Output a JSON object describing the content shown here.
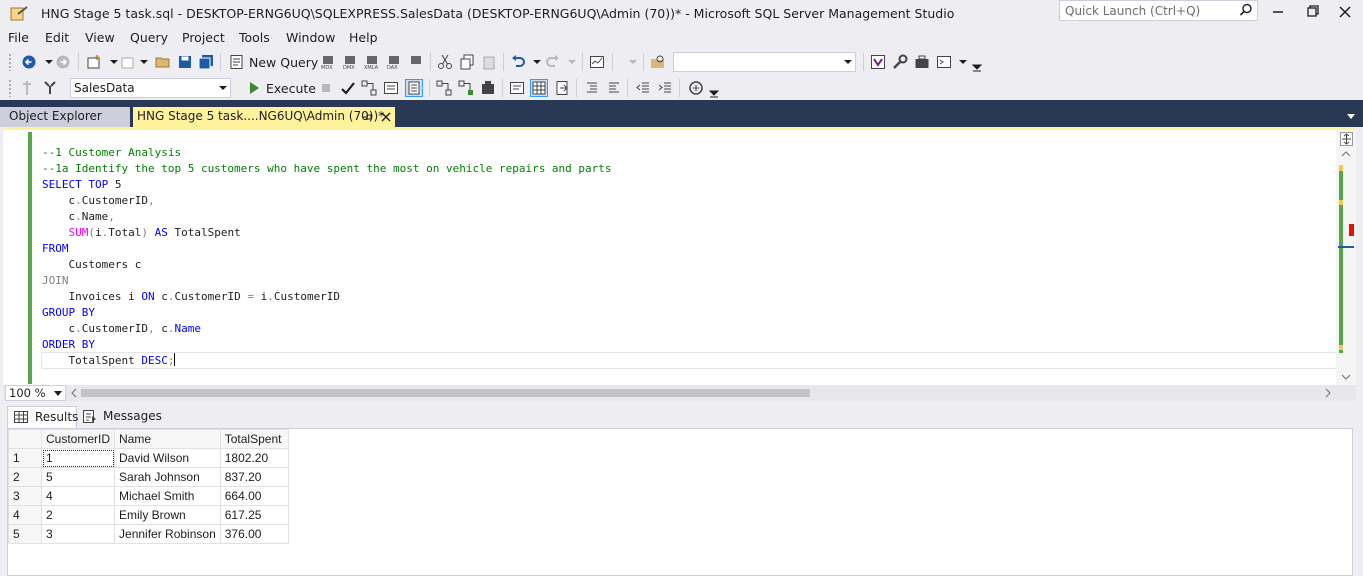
{
  "window": {
    "title": "HNG Stage 5 task.sql - DESKTOP-ERNG6UQ\\SQLEXPRESS.SalesData (DESKTOP-ERNG6UQ\\Admin (70))* - Microsoft SQL Server Management Studio",
    "quick_launch_placeholder": "Quick Launch (Ctrl+Q)"
  },
  "menu": [
    "File",
    "Edit",
    "View",
    "Query",
    "Project",
    "Tools",
    "Window",
    "Help"
  ],
  "toolbar": {
    "new_query_label": "New Query",
    "database": "SalesData",
    "execute_label": "Execute",
    "icons": [
      "back-icon",
      "forward-icon",
      "new-project-icon",
      "open-icon",
      "save-icon",
      "save-all-icon",
      "mdx-query-icon",
      "dmx-query-icon",
      "xmla-query-icon",
      "dax-query-icon",
      "cut-icon",
      "copy-icon",
      "paste-icon",
      "undo-icon",
      "redo-icon",
      "activity-monitor-icon",
      "solution-explorer-icon",
      "properties-icon",
      "toolbox-icon",
      "terminal-icon"
    ]
  },
  "tabs": {
    "object_explorer": "Object Explorer",
    "query_tab": "HNG Stage 5 task....NG6UQ\\Admin (70))*"
  },
  "editor": {
    "zoom": "100 %",
    "lines": [
      [
        [
          "cm",
          "--1 Customer Analysis"
        ]
      ],
      [
        [
          "cm",
          "--1a Identify the top 5 customers who have spent the most on vehicle repairs and parts"
        ]
      ],
      [
        [
          "kw",
          "SELECT TOP"
        ],
        [
          "tx",
          " 5"
        ]
      ],
      [
        [
          "tx",
          "    c"
        ],
        [
          "gr",
          "."
        ],
        [
          "tx",
          "CustomerID"
        ],
        [
          "gr",
          ","
        ]
      ],
      [
        [
          "tx",
          "    c"
        ],
        [
          "gr",
          "."
        ],
        [
          "tx",
          "Name"
        ],
        [
          "gr",
          ","
        ]
      ],
      [
        [
          "tx",
          "    "
        ],
        [
          "fn",
          "SUM"
        ],
        [
          "gr",
          "("
        ],
        [
          "tx",
          "i"
        ],
        [
          "gr",
          "."
        ],
        [
          "tx",
          "Total"
        ],
        [
          "gr",
          ")"
        ],
        [
          "tx",
          " "
        ],
        [
          "kw",
          "AS"
        ],
        [
          "tx",
          " TotalSpent"
        ]
      ],
      [
        [
          "kw",
          "FROM"
        ]
      ],
      [
        [
          "tx",
          "    Customers c"
        ]
      ],
      [
        [
          "gr",
          "JOIN"
        ]
      ],
      [
        [
          "tx",
          "    Invoices i "
        ],
        [
          "kw",
          "ON"
        ],
        [
          "tx",
          " c"
        ],
        [
          "gr",
          "."
        ],
        [
          "tx",
          "CustomerID "
        ],
        [
          "gr",
          "="
        ],
        [
          "tx",
          " i"
        ],
        [
          "gr",
          "."
        ],
        [
          "tx",
          "CustomerID"
        ]
      ],
      [
        [
          "kw",
          "GROUP BY"
        ]
      ],
      [
        [
          "tx",
          "    c"
        ],
        [
          "gr",
          "."
        ],
        [
          "tx",
          "CustomerID"
        ],
        [
          "gr",
          ","
        ],
        [
          "tx",
          " c"
        ],
        [
          "gr",
          "."
        ],
        [
          "kw",
          "Name"
        ]
      ],
      [
        [
          "kw",
          "ORDER BY"
        ]
      ],
      [
        [
          "tx",
          "    TotalSpent "
        ],
        [
          "kw",
          "DESC"
        ],
        [
          "gr",
          ";"
        ]
      ]
    ]
  },
  "results": {
    "tabs": [
      "Results",
      "Messages"
    ],
    "columns": [
      "CustomerID",
      "Name",
      "TotalSpent"
    ],
    "rows": [
      [
        "1",
        "1",
        "David Wilson",
        "1802.20"
      ],
      [
        "2",
        "5",
        "Sarah Johnson",
        "837.20"
      ],
      [
        "3",
        "4",
        "Michael Smith",
        "664.00"
      ],
      [
        "4",
        "2",
        "Emily Brown",
        "617.25"
      ],
      [
        "5",
        "3",
        "Jennifer Robinson",
        "376.00"
      ]
    ]
  },
  "colors": {
    "tab_strip": "#293955",
    "active_tab": "#fff29d",
    "keyword": "#0000ff",
    "comment": "#008000",
    "function": "#ff00ff",
    "operator": "#808080",
    "change_marker": "#57a64a"
  }
}
